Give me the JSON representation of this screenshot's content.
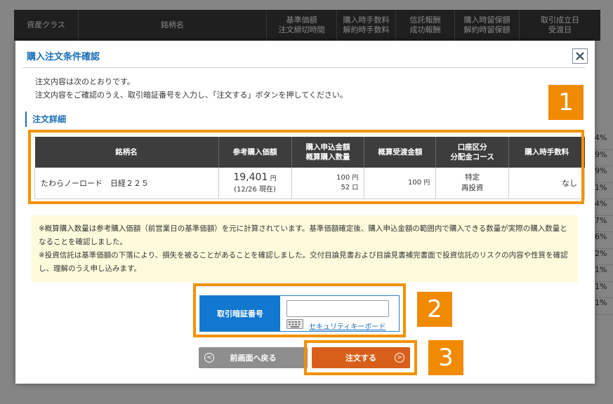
{
  "background": {
    "header_columns": [
      {
        "label": "資産クラス"
      },
      {
        "label": "銘柄名"
      },
      {
        "label": "基準価額\n注文締切時間"
      },
      {
        "label": "購入時手数料\n解約時手数料"
      },
      {
        "label": "信託報酬\n成功報酬"
      },
      {
        "label": "購入時留保額\n解約時留保額"
      },
      {
        "label": "取引成立日\n受渡日"
      }
    ],
    "right_values": [
      "4%",
      "9%",
      "9%",
      "1%",
      "4%",
      "7%",
      "6%",
      "2%",
      "1%",
      "1%",
      "1%"
    ]
  },
  "modal": {
    "title": "購入注文条件確認",
    "intro_line1": "注文内容は次のとおりです。",
    "intro_line2": "注文内容をご確認のうえ、取引暗証番号を入力し、「注文する」ボタンを押してください。",
    "section_title": "注文詳細",
    "table": {
      "headers": [
        "銘柄名",
        "参考購入価額",
        "購入申込金額\n概算購入数量",
        "概算受渡金額",
        "口座区分\n分配金コース",
        "購入時手数料"
      ],
      "row": {
        "name": "たわらノーロード　日経２２５",
        "price": "19,401",
        "price_unit": "円",
        "price_date": "(12/26 現在)",
        "amount": "100",
        "amount_unit": "円",
        "quantity": "52",
        "quantity_unit": "口",
        "settlement": "100",
        "settlement_unit": "円",
        "account": "特定",
        "course": "再投資",
        "fee": "なし"
      }
    },
    "notes": [
      "※概算購入数量は参考購入価額（前営業日の基準価額）を元に計算されています。基準価額確定後、購入申込金額の範囲内で購入できる数量が実際の購入数量となることを確認しました。",
      "※投資信託は基準価額の下落により、損失を被ることがあることを確認しました。交付目論見書および目論見書補完書面で投資信託のリスクの内容や性質を確認し、理解のうえ申し込みます。"
    ],
    "pin": {
      "label": "取引暗証番号",
      "value": "",
      "keyboard_link": "セキュリティキーボード"
    },
    "buttons": {
      "back": "前画面へ戻る",
      "order": "注文する"
    }
  },
  "badges": [
    "1",
    "2",
    "3"
  ],
  "colors": {
    "accent_blue": "#1a6fb5",
    "highlight_orange": "#f29200",
    "order_button": "#d85f1a",
    "back_button": "#8e8e8e",
    "header_dark": "#3d3d3d",
    "notes_bg": "#fdfbdc"
  }
}
